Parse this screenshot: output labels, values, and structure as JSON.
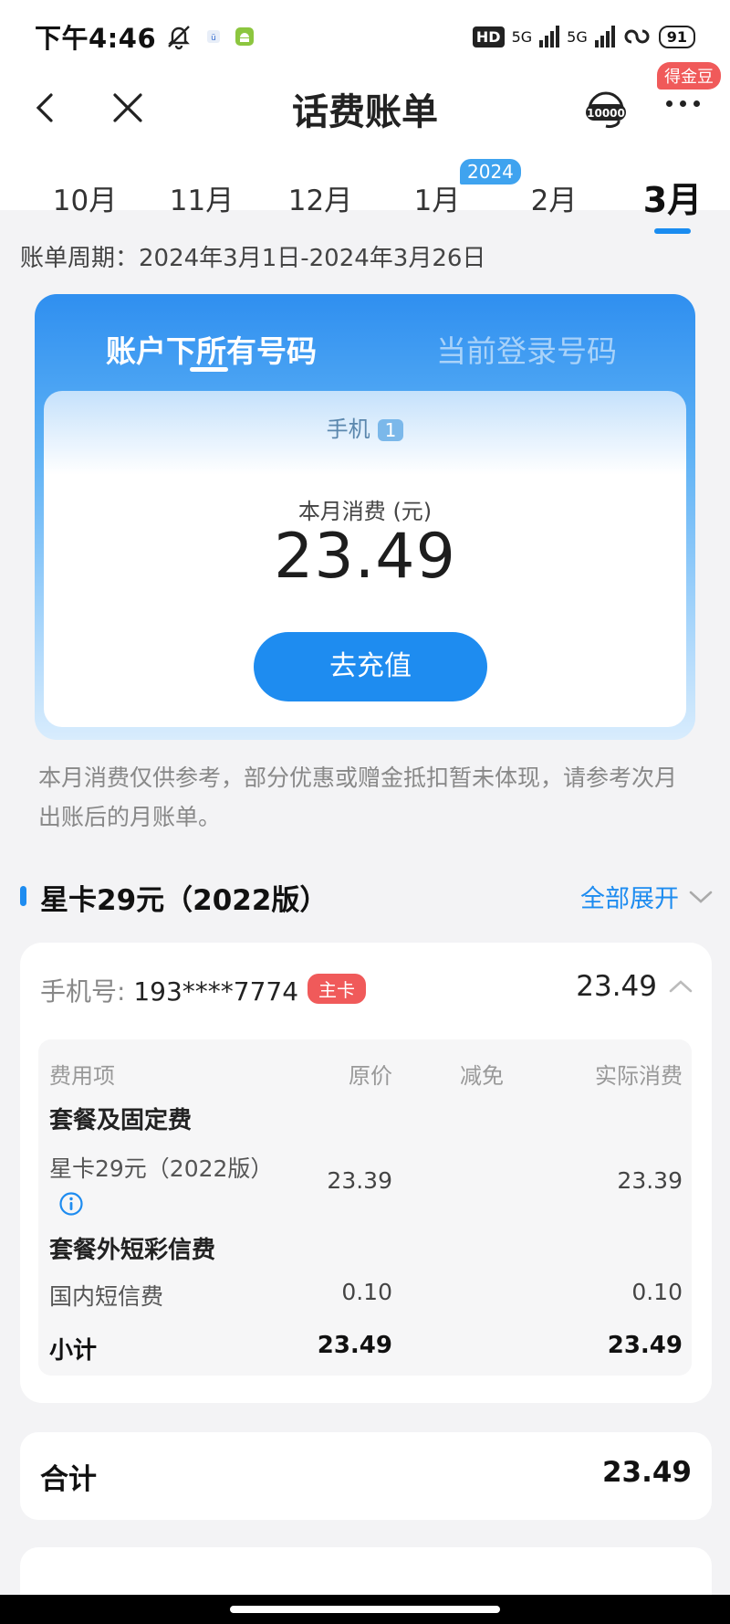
{
  "status_bar": {
    "time": "下午4:46",
    "network_a": "5G",
    "network_b": "5G",
    "hd_label": "HD",
    "battery": "91"
  },
  "header": {
    "title": "话费账单",
    "gold_badge": "得金豆",
    "service_label": "10000"
  },
  "months": {
    "items": [
      "10月",
      "11月",
      "12月",
      "1月",
      "2月",
      "3月"
    ],
    "active_index": 5,
    "year_badge": "2024"
  },
  "period": "账单周期：2024年3月1日-2024年3月26日",
  "account_card": {
    "tab_all": "账户下所有号码",
    "tab_current": "当前登录号码",
    "phone_label": "手机",
    "phone_count": "1",
    "month_spend_label": "本月消费 (元)",
    "month_spend_value": "23.49",
    "recharge_label": "去充值"
  },
  "notice": "本月消费仅供参考，部分优惠或赠金抵扣暂未体现，请参考次月出账后的月账单。",
  "plan": {
    "name": "星卡29元（2022版）",
    "expand_label": "全部展开"
  },
  "detail": {
    "phone_label": "手机号:",
    "phone_number": "193****7774",
    "main_badge": "主卡",
    "phone_total": "23.49",
    "columns": [
      "费用项",
      "原价",
      "减免",
      "实际消费"
    ],
    "category_1": "套餐及固定费",
    "item_1_name": "星卡29元（2022版）",
    "item_1_price": "23.39",
    "item_1_actual": "23.39",
    "category_2": "套餐外短彩信费",
    "item_2_name": "国内短信费",
    "item_2_price": "0.10",
    "item_2_actual": "0.10",
    "subtotal_label": "小计",
    "subtotal_price": "23.49",
    "subtotal_actual": "23.49"
  },
  "total": {
    "label": "合计",
    "value": "23.49"
  },
  "colors": {
    "accent": "#1e8cf0",
    "badge_red": "#f05a5a"
  }
}
